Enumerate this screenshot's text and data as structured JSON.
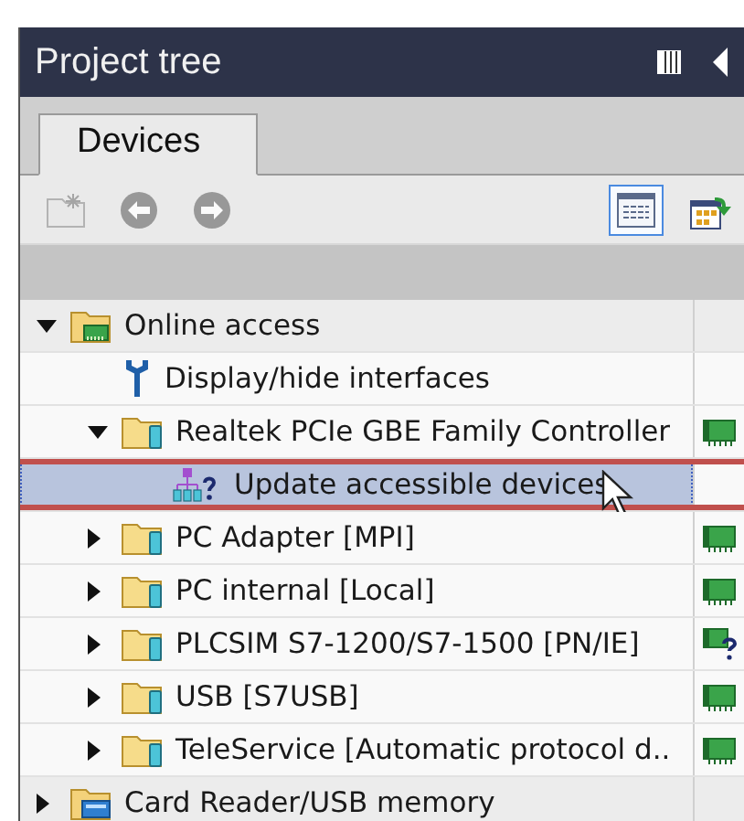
{
  "panel": {
    "title": "Project tree"
  },
  "tabs": [
    {
      "label": "Devices",
      "selected": true
    }
  ],
  "toolbar": [
    {
      "kind": "new-folder",
      "disabled": true,
      "selected": false
    },
    {
      "kind": "back",
      "disabled": true,
      "selected": false
    },
    {
      "kind": "forward",
      "disabled": true,
      "selected": false
    },
    {
      "kind": "list-view",
      "disabled": false,
      "selected": true
    },
    {
      "kind": "export",
      "disabled": false,
      "selected": false
    }
  ],
  "tree": [
    {
      "label": "Online access",
      "kind": "folder-network",
      "expanded": true,
      "selected": false,
      "children": [
        {
          "label": "Display/hide interfaces",
          "kind": "wrench",
          "selected": false
        },
        {
          "label": "Realtek PCIe GBE Family Controller",
          "kind": "folder-device",
          "expanded": true,
          "selected": false,
          "status": {
            "kind": "network"
          },
          "children": [
            {
              "label": "Update accessible devices",
              "kind": "network-query",
              "selected": true
            }
          ]
        },
        {
          "label": "PC Adapter [MPI]",
          "kind": "folder-device",
          "expanded": false,
          "selected": false,
          "status": {
            "kind": "network"
          }
        },
        {
          "label": "PC internal [Local]",
          "kind": "folder-device",
          "expanded": false,
          "selected": false,
          "status": {
            "kind": "network"
          }
        },
        {
          "label": "PLCSIM S7-1200/S7-1500 [PN/IE]",
          "kind": "folder-device",
          "expanded": false,
          "selected": false,
          "status": {
            "kind": "network-query"
          }
        },
        {
          "label": "USB [S7USB]",
          "kind": "folder-device",
          "expanded": false,
          "selected": false,
          "status": {
            "kind": "network"
          }
        },
        {
          "label": "TeleService [Automatic protocol d..",
          "kind": "folder-device",
          "expanded": false,
          "selected": false,
          "status": {
            "kind": "network"
          }
        }
      ]
    },
    {
      "label": "Card Reader/USB memory",
      "kind": "card-reader",
      "expanded": false,
      "selected": false
    }
  ]
}
